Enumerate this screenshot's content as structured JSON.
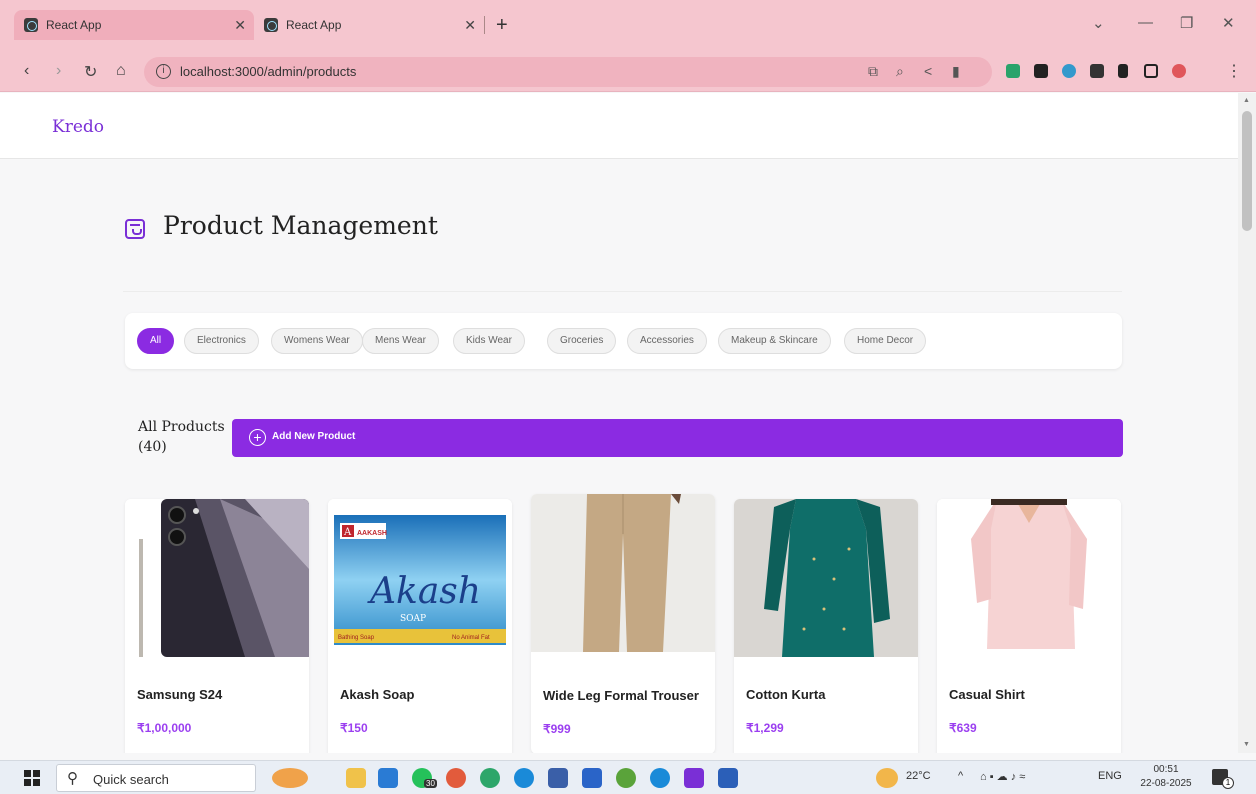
{
  "browser": {
    "tabs": [
      {
        "title": "React App"
      },
      {
        "title": "React App"
      }
    ],
    "url": "localhost:3000/admin/products"
  },
  "app": {
    "brand": "Kredo",
    "page_title": "Product Management",
    "categories": [
      "All",
      "Electronics",
      "Womens Wear",
      "Mens Wear",
      "Kids Wear",
      "Groceries",
      "Accessories",
      "Makeup & Skincare",
      "Home Decor"
    ],
    "active_category": "All",
    "count_label": "All Products (40)",
    "add_button_label": "Add New Product",
    "products": [
      {
        "name": "Samsung S24",
        "price": "₹1,00,000"
      },
      {
        "name": "Akash Soap",
        "price": "₹150"
      },
      {
        "name": "Wide Leg Formal Trouser",
        "price": "₹999"
      },
      {
        "name": "Cotton Kurta",
        "price": "₹1,299"
      },
      {
        "name": "Casual Shirt",
        "price": "₹639"
      }
    ],
    "soap_pack": {
      "brand": "AAKASH",
      "logo": "Akash",
      "word": "SOAP",
      "left_tag": "Bathing Soap",
      "right_tag": "No Animal Fat"
    }
  },
  "taskbar": {
    "search_placeholder": "Quick search",
    "whatsapp_badge": "30",
    "weather_temp": "22°C",
    "language": "ENG",
    "time": "00:51",
    "date": "22-08-2025",
    "notification_count": "1"
  },
  "colors": {
    "accent": "#8b2be2",
    "price": "#9b3ff0",
    "chrome": "#f5c6cf"
  }
}
